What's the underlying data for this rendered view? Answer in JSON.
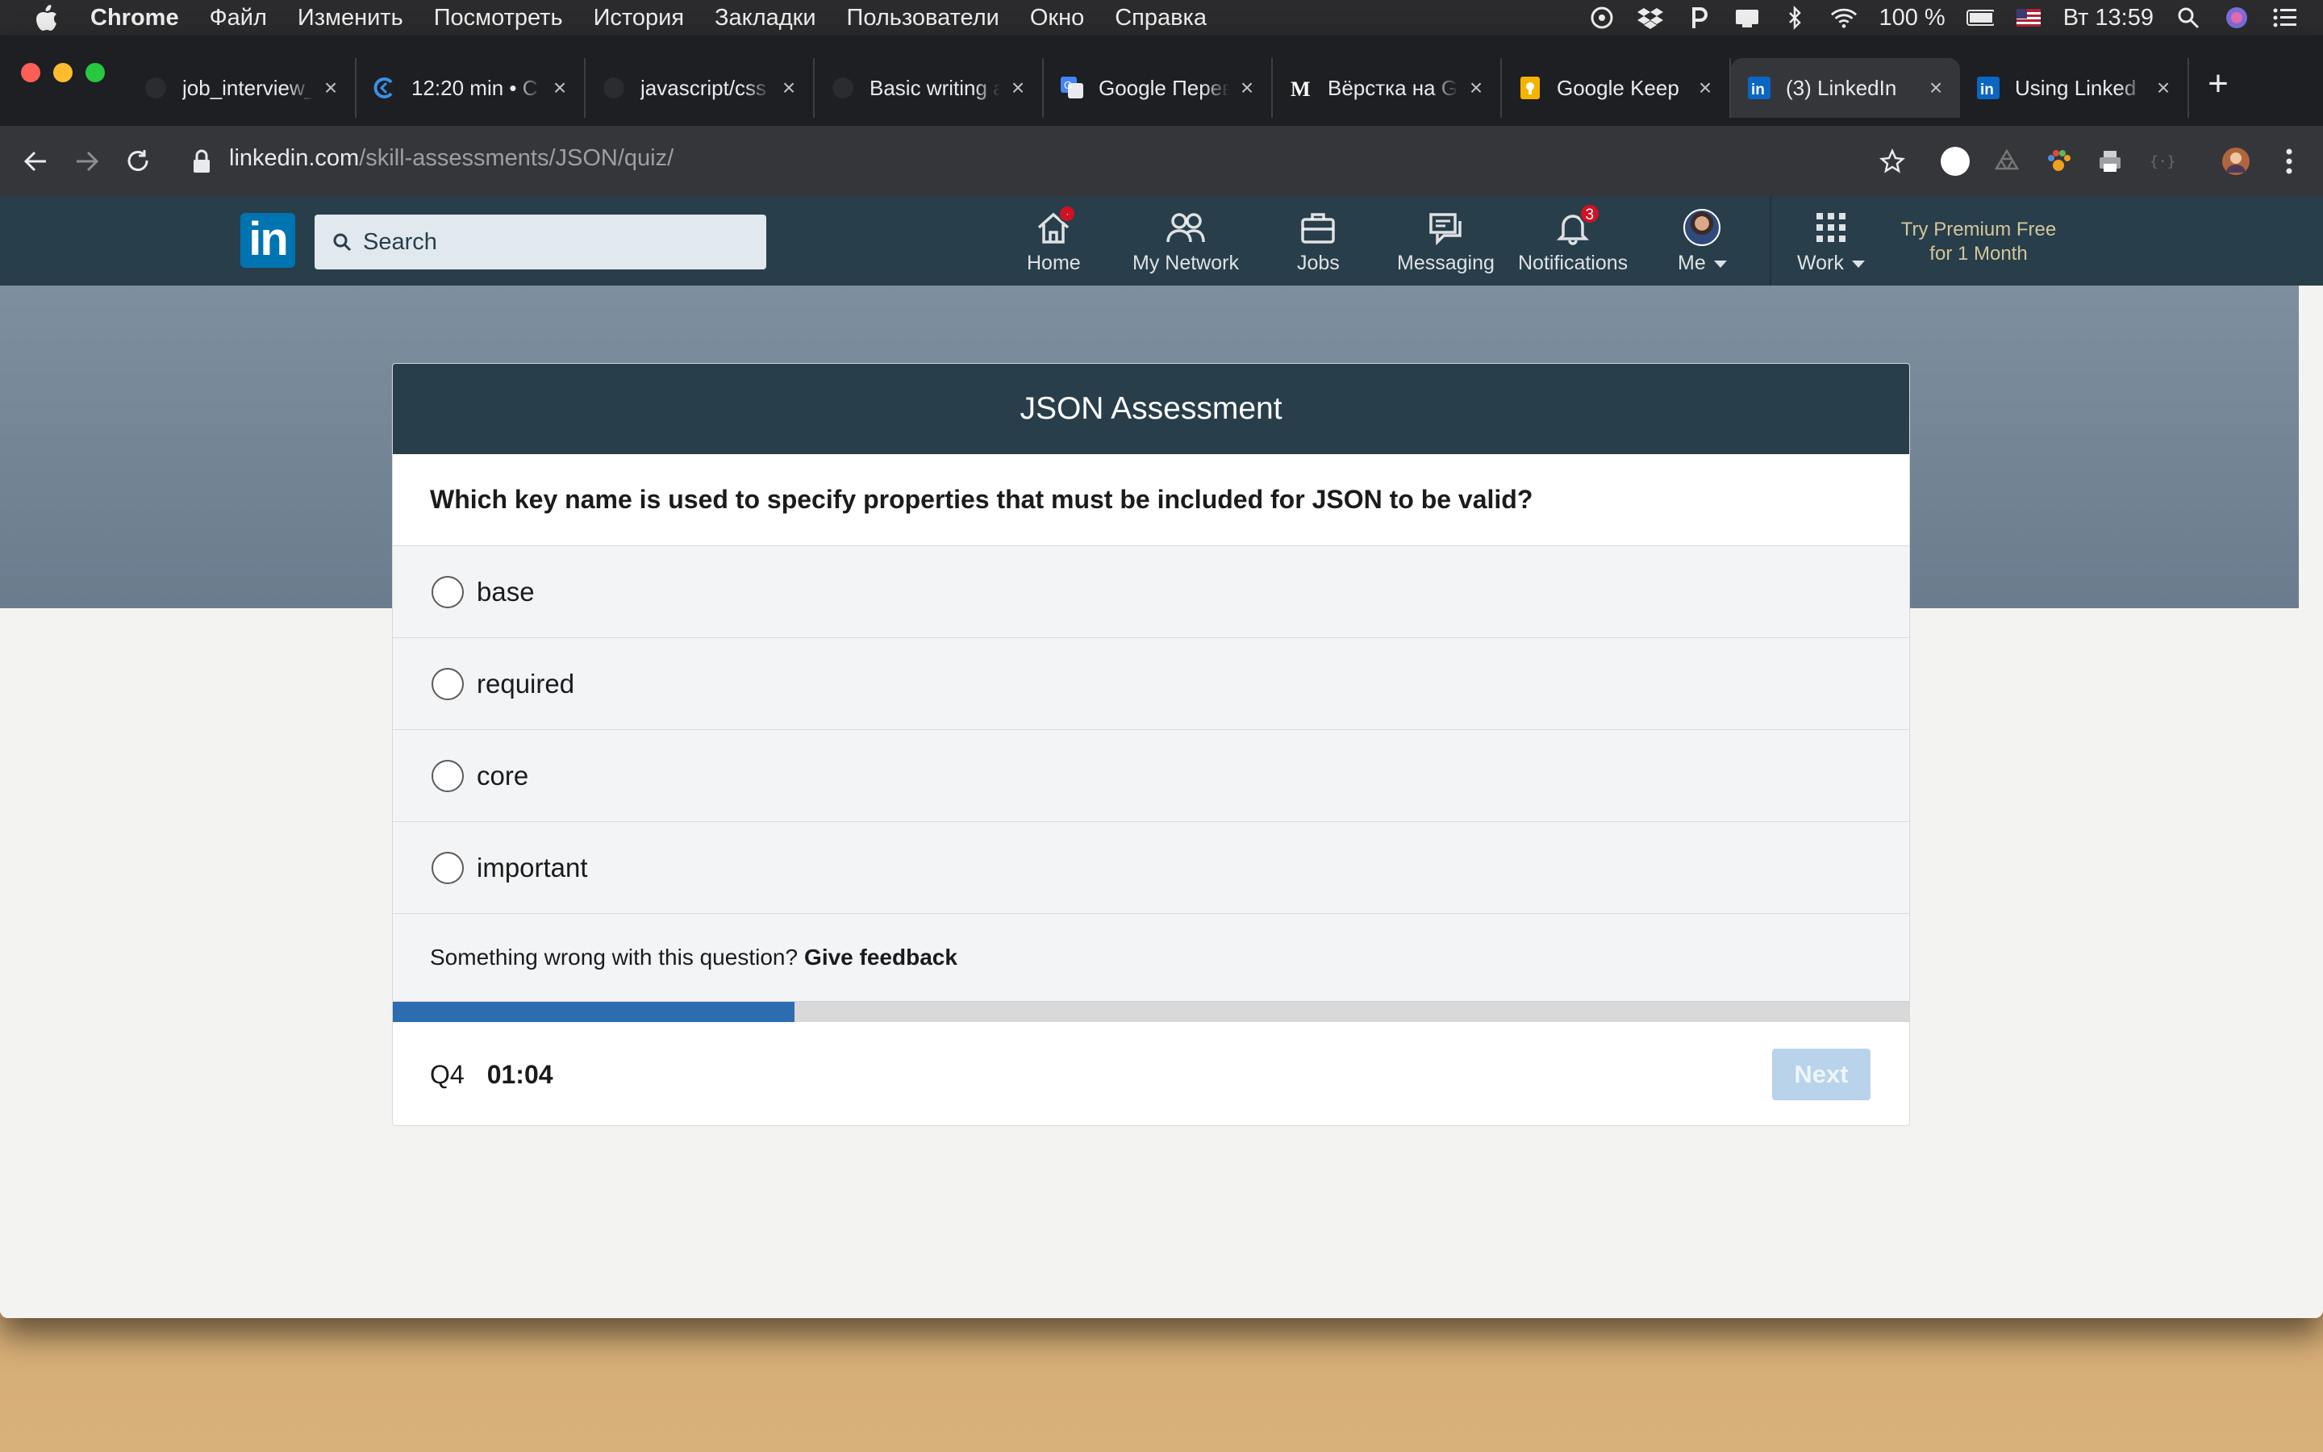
{
  "menubar": {
    "app": "Chrome",
    "items": [
      "Файл",
      "Изменить",
      "Посмотреть",
      "История",
      "Закладки",
      "Пользователи",
      "Окно",
      "Справка"
    ],
    "battery": "100 %",
    "clock": "Вт 13:59"
  },
  "browser": {
    "tabs": [
      {
        "title": "job_interview_",
        "icon": "github-icon"
      },
      {
        "title": "12:20 min • C",
        "icon": "clock-icon"
      },
      {
        "title": "javascript/css",
        "icon": "github-icon"
      },
      {
        "title": "Basic writing a",
        "icon": "github-icon"
      },
      {
        "title": "Google Перев",
        "icon": "translate-icon"
      },
      {
        "title": "Вёрстка на G",
        "icon": "medium-icon"
      },
      {
        "title": "Google Keep",
        "icon": "keep-icon"
      },
      {
        "title": "(3) LinkedIn",
        "icon": "linkedin-icon",
        "active": true
      },
      {
        "title": "Using Linked",
        "icon": "linkedin-icon"
      }
    ],
    "url_host": "linkedin.com",
    "url_path": "/skill-assessments/JSON/quiz/"
  },
  "linkedin": {
    "logo_text": "in",
    "search_placeholder": "Search",
    "nav": {
      "home": "Home",
      "network": "My Network",
      "jobs": "Jobs",
      "messaging": "Messaging",
      "notifications": "Notifications",
      "notifications_count": "3",
      "me": "Me",
      "work": "Work"
    },
    "premium_line1": "Try Premium Free",
    "premium_line2": "for 1 Month"
  },
  "quiz": {
    "title": "JSON Assessment",
    "question": "Which key name is used to specify properties that must be included for JSON to be valid?",
    "options": [
      "base",
      "required",
      "core",
      "important"
    ],
    "feedback_prefix": "Something wrong with this question?",
    "feedback_link": "Give feedback",
    "progress_percent": 26.5,
    "question_number": "Q4",
    "timer": "01:04",
    "next_label": "Next"
  },
  "colors": {
    "linkedin_header": "#283e4a",
    "linkedin_blue": "#0073b1",
    "progress_fill": "#2c6db1",
    "next_disabled": "#b8d3ea"
  }
}
